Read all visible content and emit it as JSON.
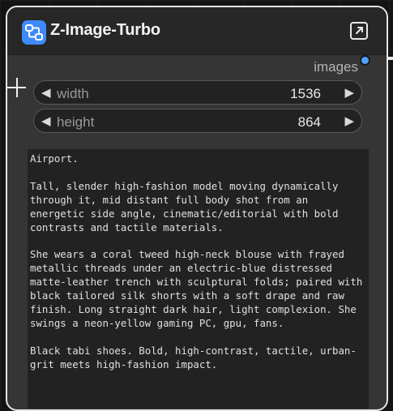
{
  "node": {
    "title": "Z-Image-Turbo",
    "icon": "workflow-icon",
    "accent_color": "#3d8bfd"
  },
  "output": {
    "label": "images",
    "dot_color": "#4da3ff"
  },
  "widgets": {
    "width": {
      "label": "width",
      "value": "1536"
    },
    "height": {
      "label": "height",
      "value": "864"
    }
  },
  "prompt": {
    "text": "Airport.\n\nTall, slender high-fashion model moving dynamically through it, mid distant full body shot from an energetic side angle, cinematic/editorial with bold contrasts and tactile materials.\n\nShe wears a coral tweed high-neck blouse with frayed metallic threads under an electric-blue distressed matte-leather trench with sculptural folds; paired with black tailored silk shorts with a soft drape and raw finish. Long straight dark hair, light complexion. She swings a neon-yellow gaming PC, gpu, fans.\n\nBlack tabi shoes. Bold, high-contrast, tactile, urban-grit meets high-fashion impact."
  }
}
